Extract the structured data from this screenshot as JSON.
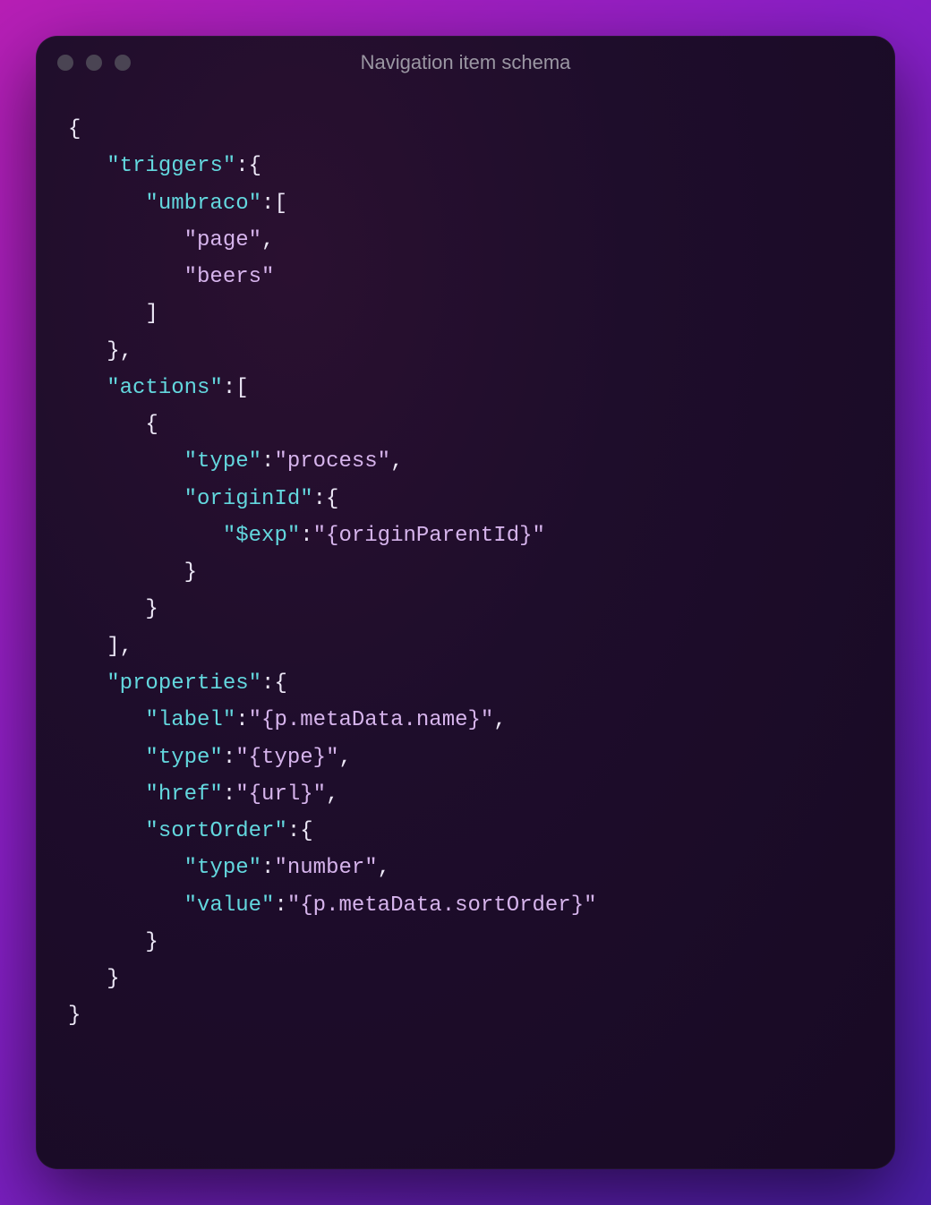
{
  "window": {
    "title": "Navigation item schema"
  },
  "code": {
    "triggers_key": "\"triggers\"",
    "umbraco_key": "\"umbraco\"",
    "umbraco_val_0": "\"page\"",
    "umbraco_val_1": "\"beers\"",
    "actions_key": "\"actions\"",
    "type_key": "\"type\"",
    "type_val_process": "\"process\"",
    "originId_key": "\"originId\"",
    "exp_key": "\"$exp\"",
    "exp_val": "\"{originParentId}\"",
    "properties_key": "\"properties\"",
    "label_key": "\"label\"",
    "label_val": "\"{p.metaData.name}\"",
    "type_key2": "\"type\"",
    "type_val_type": "\"{type}\"",
    "href_key": "\"href\"",
    "href_val": "\"{url}\"",
    "sortOrder_key": "\"sortOrder\"",
    "sortOrder_type_key": "\"type\"",
    "sortOrder_type_val": "\"number\"",
    "sortOrder_value_key": "\"value\"",
    "sortOrder_value_val": "\"{p.metaData.sortOrder}\""
  }
}
